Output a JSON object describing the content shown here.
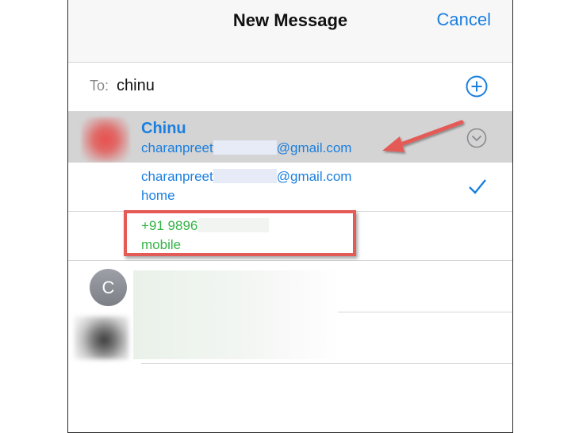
{
  "navbar": {
    "title": "New Message",
    "cancel_label": "Cancel"
  },
  "recipient": {
    "to_label": "To:",
    "value": "chinu",
    "add_icon": "plus-circle-icon"
  },
  "contact": {
    "name": "Chinu",
    "email_prefix": "charanpreet",
    "email_suffix": "@gmail.com",
    "expand_icon": "chevron-down-circle-icon"
  },
  "options": [
    {
      "prefix": "charanpreet",
      "suffix": "@gmail.com",
      "type": "home",
      "selected": true
    },
    {
      "prefix": "+91 9896",
      "suffix": "",
      "type": "mobile",
      "selected": false
    }
  ],
  "other_contacts": [
    {
      "initial": "C"
    }
  ],
  "colors": {
    "accent": "#1a7fe0",
    "phone_green": "#35b347",
    "annotation_red": "#e45a57",
    "selected_row_bg": "#d4d4d4"
  }
}
